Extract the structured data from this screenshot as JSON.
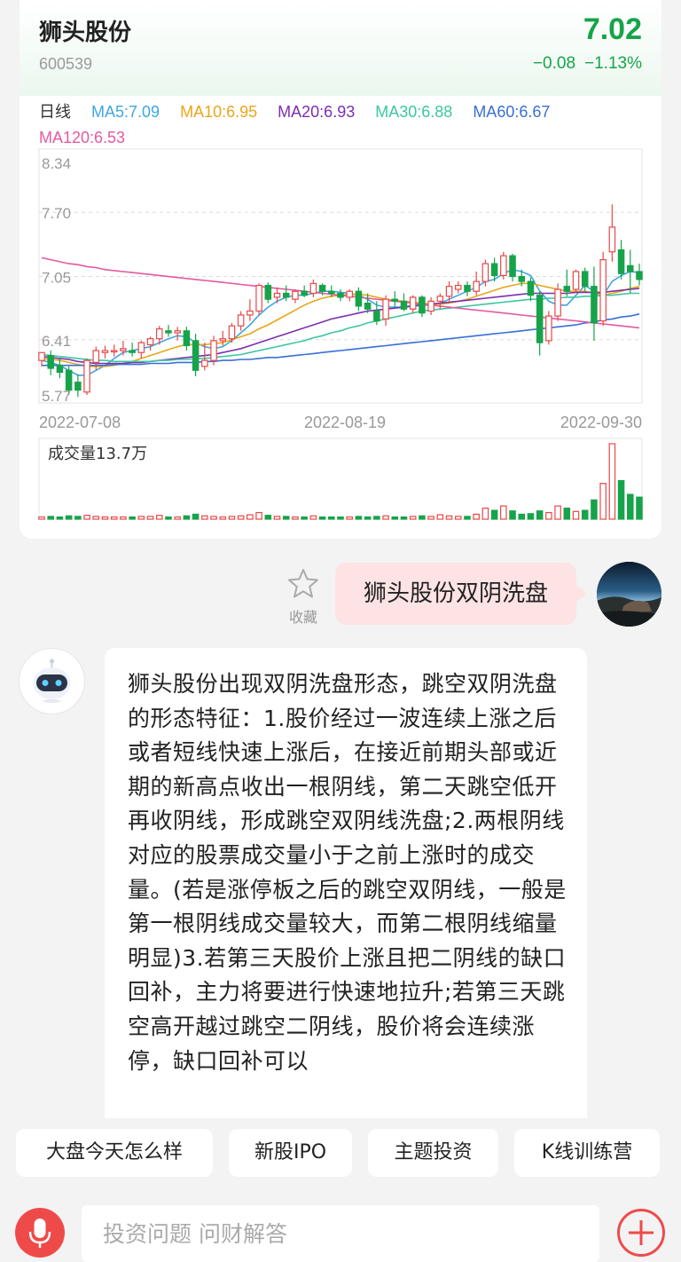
{
  "stock": {
    "name": "狮头股份",
    "code": "600539",
    "price": "7.02",
    "change": "−0.08",
    "change_pct": "−1.13%",
    "down_color": "#17a34a",
    "up_color": "#e8484a"
  },
  "ma_legend": [
    {
      "label": "日线",
      "color": "#333333"
    },
    {
      "label": "MA5:7.09",
      "color": "#3fa7dd"
    },
    {
      "label": "MA10:6.95",
      "color": "#e9a619"
    },
    {
      "label": "MA20:6.93",
      "color": "#7b2fb0"
    },
    {
      "label": "MA30:6.88",
      "color": "#3cc7a0"
    },
    {
      "label": "MA60:6.67",
      "color": "#3a6fd6"
    },
    {
      "label": "MA120:6.53",
      "color": "#e35aa0"
    }
  ],
  "chart_data": {
    "type": "candlestick",
    "y_ticks": [
      "8.34",
      "7.70",
      "7.05",
      "6.41",
      "5.77"
    ],
    "y_range": [
      5.77,
      8.34
    ],
    "x_ticks": [
      "2022-07-08",
      "2022-08-19",
      "2022-09-30"
    ],
    "volume_label": "成交量13.7万",
    "grid": true,
    "candles": [
      {
        "o": 6.2,
        "h": 6.26,
        "l": 6.14,
        "c": 6.28
      },
      {
        "o": 6.25,
        "h": 6.3,
        "l": 6.05,
        "c": 6.12
      },
      {
        "o": 6.15,
        "h": 6.22,
        "l": 6.02,
        "c": 6.08
      },
      {
        "o": 6.1,
        "h": 6.14,
        "l": 5.85,
        "c": 5.9
      },
      {
        "o": 5.98,
        "h": 6.06,
        "l": 5.83,
        "c": 5.9
      },
      {
        "o": 5.88,
        "h": 6.22,
        "l": 5.85,
        "c": 6.2
      },
      {
        "o": 6.18,
        "h": 6.34,
        "l": 6.1,
        "c": 6.3
      },
      {
        "o": 6.28,
        "h": 6.35,
        "l": 6.22,
        "c": 6.3
      },
      {
        "o": 6.3,
        "h": 6.36,
        "l": 6.24,
        "c": 6.3
      },
      {
        "o": 6.3,
        "h": 6.4,
        "l": 6.25,
        "c": 6.32
      },
      {
        "o": 6.3,
        "h": 6.38,
        "l": 6.24,
        "c": 6.28
      },
      {
        "o": 6.28,
        "h": 6.4,
        "l": 6.22,
        "c": 6.38
      },
      {
        "o": 6.36,
        "h": 6.44,
        "l": 6.3,
        "c": 6.42
      },
      {
        "o": 6.42,
        "h": 6.55,
        "l": 6.36,
        "c": 6.52
      },
      {
        "o": 6.5,
        "h": 6.56,
        "l": 6.44,
        "c": 6.48
      },
      {
        "o": 6.48,
        "h": 6.54,
        "l": 6.4,
        "c": 6.5
      },
      {
        "o": 6.5,
        "h": 6.54,
        "l": 6.3,
        "c": 6.35
      },
      {
        "o": 6.4,
        "h": 6.47,
        "l": 6.04,
        "c": 6.1
      },
      {
        "o": 6.14,
        "h": 6.38,
        "l": 6.1,
        "c": 6.2
      },
      {
        "o": 6.2,
        "h": 6.45,
        "l": 6.15,
        "c": 6.4
      },
      {
        "o": 6.4,
        "h": 6.5,
        "l": 6.35,
        "c": 6.42
      },
      {
        "o": 6.42,
        "h": 6.58,
        "l": 6.38,
        "c": 6.55
      },
      {
        "o": 6.55,
        "h": 6.7,
        "l": 6.5,
        "c": 6.66
      },
      {
        "o": 6.66,
        "h": 6.82,
        "l": 6.6,
        "c": 6.7
      },
      {
        "o": 6.7,
        "h": 6.98,
        "l": 6.66,
        "c": 6.96
      },
      {
        "o": 6.96,
        "h": 6.99,
        "l": 6.78,
        "c": 6.82
      },
      {
        "o": 6.84,
        "h": 6.94,
        "l": 6.78,
        "c": 6.88
      },
      {
        "o": 6.88,
        "h": 6.96,
        "l": 6.8,
        "c": 6.84
      },
      {
        "o": 6.82,
        "h": 6.92,
        "l": 6.78,
        "c": 6.9
      },
      {
        "o": 6.9,
        "h": 6.96,
        "l": 6.84,
        "c": 6.86
      },
      {
        "o": 6.88,
        "h": 7.02,
        "l": 6.84,
        "c": 6.98
      },
      {
        "o": 6.96,
        "h": 6.98,
        "l": 6.86,
        "c": 6.9
      },
      {
        "o": 6.9,
        "h": 6.96,
        "l": 6.84,
        "c": 6.88
      },
      {
        "o": 6.88,
        "h": 6.92,
        "l": 6.8,
        "c": 6.84
      },
      {
        "o": 6.84,
        "h": 6.92,
        "l": 6.8,
        "c": 6.9
      },
      {
        "o": 6.9,
        "h": 6.94,
        "l": 6.7,
        "c": 6.75
      },
      {
        "o": 6.78,
        "h": 6.88,
        "l": 6.68,
        "c": 6.72
      },
      {
        "o": 6.7,
        "h": 6.8,
        "l": 6.56,
        "c": 6.6
      },
      {
        "o": 6.62,
        "h": 6.86,
        "l": 6.55,
        "c": 6.82
      },
      {
        "o": 6.82,
        "h": 6.9,
        "l": 6.74,
        "c": 6.8
      },
      {
        "o": 6.8,
        "h": 6.88,
        "l": 6.7,
        "c": 6.72
      },
      {
        "o": 6.72,
        "h": 6.86,
        "l": 6.68,
        "c": 6.84
      },
      {
        "o": 6.84,
        "h": 6.86,
        "l": 6.64,
        "c": 6.68
      },
      {
        "o": 6.7,
        "h": 6.84,
        "l": 6.66,
        "c": 6.8
      },
      {
        "o": 6.8,
        "h": 6.88,
        "l": 6.72,
        "c": 6.85
      },
      {
        "o": 6.85,
        "h": 7.0,
        "l": 6.8,
        "c": 6.95
      },
      {
        "o": 6.92,
        "h": 7.0,
        "l": 6.88,
        "c": 6.96
      },
      {
        "o": 6.96,
        "h": 7.0,
        "l": 6.85,
        "c": 6.9
      },
      {
        "o": 6.9,
        "h": 7.1,
        "l": 6.86,
        "c": 7.0
      },
      {
        "o": 7.0,
        "h": 7.22,
        "l": 6.95,
        "c": 7.18
      },
      {
        "o": 7.18,
        "h": 7.24,
        "l": 7.0,
        "c": 7.06
      },
      {
        "o": 7.06,
        "h": 7.3,
        "l": 7.02,
        "c": 7.26
      },
      {
        "o": 7.26,
        "h": 7.28,
        "l": 7.0,
        "c": 7.05
      },
      {
        "o": 7.05,
        "h": 7.12,
        "l": 6.95,
        "c": 7.0
      },
      {
        "o": 7.0,
        "h": 7.04,
        "l": 6.8,
        "c": 6.86
      },
      {
        "o": 6.86,
        "h": 6.9,
        "l": 6.25,
        "c": 6.38
      },
      {
        "o": 6.4,
        "h": 6.7,
        "l": 6.36,
        "c": 6.65
      },
      {
        "o": 6.65,
        "h": 6.98,
        "l": 6.6,
        "c": 6.92
      },
      {
        "o": 6.95,
        "h": 7.12,
        "l": 6.85,
        "c": 6.9
      },
      {
        "o": 6.92,
        "h": 7.12,
        "l": 6.88,
        "c": 7.1
      },
      {
        "o": 7.1,
        "h": 7.14,
        "l": 6.9,
        "c": 6.95
      },
      {
        "o": 6.95,
        "h": 7.15,
        "l": 6.4,
        "c": 6.58
      },
      {
        "o": 6.6,
        "h": 7.3,
        "l": 6.55,
        "c": 7.22
      },
      {
        "o": 7.3,
        "h": 7.78,
        "l": 7.2,
        "c": 7.55
      },
      {
        "o": 7.32,
        "h": 7.42,
        "l": 7.02,
        "c": 7.08
      },
      {
        "o": 7.16,
        "h": 7.32,
        "l": 6.88,
        "c": 7.1
      },
      {
        "o": 7.1,
        "h": 7.18,
        "l": 6.96,
        "c": 7.02
      }
    ],
    "ma_lines": [
      {
        "name": "MA5",
        "color": "#3fa7dd",
        "values": [
          6.2,
          6.18,
          6.15,
          6.1,
          6.05,
          6.05,
          6.1,
          6.15,
          6.22,
          6.28,
          6.3,
          6.32,
          6.34,
          6.38,
          6.42,
          6.45,
          6.44,
          6.38,
          6.34,
          6.32,
          6.34,
          6.4,
          6.48,
          6.56,
          6.66,
          6.74,
          6.8,
          6.84,
          6.86,
          6.86,
          6.88,
          6.9,
          6.9,
          6.89,
          6.88,
          6.86,
          6.82,
          6.76,
          6.74,
          6.74,
          6.74,
          6.76,
          6.76,
          6.76,
          6.78,
          6.82,
          6.86,
          6.9,
          6.94,
          7.0,
          7.02,
          7.08,
          7.12,
          7.1,
          7.06,
          6.9,
          6.8,
          6.76,
          6.76,
          6.86,
          6.96,
          6.9,
          6.86,
          7.0,
          7.06,
          7.1,
          7.09
        ]
      },
      {
        "name": "MA10",
        "color": "#e9a619",
        "values": [
          6.22,
          6.21,
          6.2,
          6.18,
          6.16,
          6.14,
          6.14,
          6.14,
          6.15,
          6.17,
          6.19,
          6.22,
          6.25,
          6.28,
          6.31,
          6.34,
          6.36,
          6.36,
          6.36,
          6.37,
          6.38,
          6.41,
          6.44,
          6.47,
          6.52,
          6.56,
          6.61,
          6.66,
          6.71,
          6.76,
          6.8,
          6.83,
          6.85,
          6.86,
          6.87,
          6.87,
          6.86,
          6.84,
          6.82,
          6.81,
          6.8,
          6.79,
          6.78,
          6.77,
          6.77,
          6.78,
          6.8,
          6.82,
          6.85,
          6.88,
          6.91,
          6.94,
          6.96,
          6.98,
          6.98,
          6.96,
          6.94,
          6.92,
          6.9,
          6.9,
          6.9,
          6.88,
          6.86,
          6.88,
          6.9,
          6.93,
          6.95
        ]
      },
      {
        "name": "MA20",
        "color": "#7b2fb0",
        "values": [
          6.24,
          6.23,
          6.22,
          6.21,
          6.19,
          6.18,
          6.17,
          6.17,
          6.17,
          6.17,
          6.18,
          6.18,
          6.19,
          6.2,
          6.21,
          6.22,
          6.23,
          6.24,
          6.25,
          6.26,
          6.28,
          6.3,
          6.32,
          6.35,
          6.38,
          6.41,
          6.44,
          6.47,
          6.5,
          6.53,
          6.56,
          6.59,
          6.62,
          6.64,
          6.66,
          6.68,
          6.7,
          6.71,
          6.72,
          6.73,
          6.74,
          6.75,
          6.76,
          6.77,
          6.78,
          6.79,
          6.8,
          6.81,
          6.82,
          6.83,
          6.84,
          6.85,
          6.86,
          6.87,
          6.88,
          6.88,
          6.88,
          6.88,
          6.88,
          6.89,
          6.89,
          6.89,
          6.89,
          6.9,
          6.91,
          6.92,
          6.93
        ]
      },
      {
        "name": "MA30",
        "color": "#3cc7a0",
        "values": [
          6.26,
          6.25,
          6.24,
          6.23,
          6.22,
          6.21,
          6.2,
          6.2,
          6.19,
          6.19,
          6.19,
          6.19,
          6.19,
          6.2,
          6.2,
          6.21,
          6.21,
          6.22,
          6.22,
          6.23,
          6.24,
          6.25,
          6.26,
          6.28,
          6.3,
          6.32,
          6.34,
          6.36,
          6.38,
          6.4,
          6.43,
          6.45,
          6.48,
          6.5,
          6.53,
          6.55,
          6.58,
          6.6,
          6.62,
          6.64,
          6.66,
          6.68,
          6.7,
          6.71,
          6.72,
          6.73,
          6.74,
          6.75,
          6.76,
          6.77,
          6.78,
          6.79,
          6.8,
          6.81,
          6.82,
          6.82,
          6.83,
          6.83,
          6.84,
          6.84,
          6.85,
          6.85,
          6.86,
          6.86,
          6.87,
          6.88,
          6.88
        ]
      },
      {
        "name": "MA60",
        "color": "#3a6fd6",
        "values": [
          6.15,
          6.15,
          6.15,
          6.15,
          6.15,
          6.15,
          6.15,
          6.15,
          6.16,
          6.16,
          6.16,
          6.16,
          6.17,
          6.17,
          6.17,
          6.18,
          6.18,
          6.18,
          6.19,
          6.19,
          6.2,
          6.2,
          6.21,
          6.21,
          6.22,
          6.23,
          6.23,
          6.24,
          6.25,
          6.26,
          6.27,
          6.28,
          6.29,
          6.3,
          6.31,
          6.32,
          6.33,
          6.34,
          6.35,
          6.36,
          6.37,
          6.38,
          6.39,
          6.4,
          6.41,
          6.42,
          6.43,
          6.44,
          6.45,
          6.46,
          6.47,
          6.48,
          6.49,
          6.5,
          6.51,
          6.52,
          6.53,
          6.54,
          6.55,
          6.56,
          6.58,
          6.59,
          6.61,
          6.62,
          6.64,
          6.65,
          6.67
        ]
      },
      {
        "name": "MA120",
        "color": "#e35aa0",
        "values": [
          7.24,
          7.22,
          7.2,
          7.18,
          7.17,
          7.15,
          7.14,
          7.12,
          7.11,
          7.1,
          7.09,
          7.08,
          7.07,
          7.06,
          7.05,
          7.04,
          7.03,
          7.02,
          7.01,
          7.0,
          6.99,
          6.98,
          6.97,
          6.96,
          6.95,
          6.94,
          6.93,
          6.92,
          6.91,
          6.9,
          6.89,
          6.88,
          6.87,
          6.86,
          6.85,
          6.84,
          6.83,
          6.82,
          6.81,
          6.8,
          6.79,
          6.78,
          6.77,
          6.76,
          6.75,
          6.74,
          6.73,
          6.72,
          6.71,
          6.7,
          6.69,
          6.68,
          6.67,
          6.66,
          6.65,
          6.64,
          6.63,
          6.62,
          6.61,
          6.6,
          6.59,
          6.58,
          6.57,
          6.56,
          6.55,
          6.54,
          6.53
        ]
      }
    ],
    "volumes": [
      0.4,
      0.5,
      0.4,
      0.6,
      0.5,
      0.7,
      0.5,
      0.4,
      0.4,
      0.4,
      0.4,
      0.5,
      0.5,
      0.7,
      0.4,
      0.4,
      0.6,
      0.9,
      0.6,
      0.5,
      0.4,
      0.5,
      0.6,
      0.8,
      1.2,
      0.7,
      0.5,
      0.5,
      0.4,
      0.4,
      0.6,
      0.4,
      0.4,
      0.4,
      0.4,
      0.5,
      0.4,
      0.5,
      0.6,
      0.4,
      0.4,
      0.5,
      0.6,
      0.5,
      0.8,
      0.6,
      0.5,
      0.5,
      0.9,
      2.0,
      1.6,
      2.4,
      1.5,
      0.9,
      1.0,
      1.5,
      1.2,
      2.4,
      2.0,
      1.4,
      1.6,
      3.5,
      6.5,
      13.7,
      7.0,
      4.5,
      4.0
    ]
  },
  "chat": {
    "favorite_label": "收藏",
    "user_message": "狮头股份双阴洗盘",
    "bot_message": "狮头股份出现双阴洗盘形态，跳空双阴洗盘的形态特征：1.股价经过一波连续上涨之后或者短线快速上涨后，在接近前期头部或近期的新高点收出一根阴线，第二天跳空低开再收阴线，形成跳空双阴线洗盘;2.两根阴线对应的股票成交量小于之前上涨时的成交量。(若是涨停板之后的跳空双阴线，一般是第一根阴线成交量较大，而第二根阴线缩量明显)3.若第三天股价上涨且把二阴线的缺口回补，主力将要进行快速地拉升;若第三天跳空高开越过跳空二阴线，股价将会连续涨停，缺口回补可以"
  },
  "quick_chips": [
    "大盘今天怎么样",
    "新股IPO",
    "主题投资",
    "K线训练营"
  ],
  "input": {
    "placeholder": "投资问题 问财解答"
  }
}
